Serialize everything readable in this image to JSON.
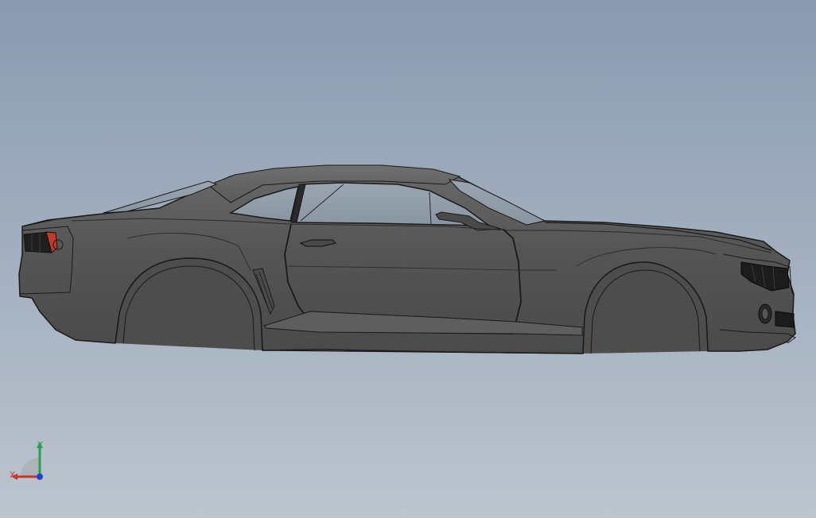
{
  "viewport": {
    "background_top": "#8a9bb0",
    "background_bottom": "#bcc4ce"
  },
  "model": {
    "body_color": "#565656",
    "edge_color": "#1a1a1a",
    "glass_color": "#8f9aa6",
    "taillight_color": "#c0392b"
  },
  "triad": {
    "x_label": "X",
    "y_label": "Y",
    "x_color": "#c0392b",
    "y_color": "#27a14a",
    "z_color": "#2240c8"
  }
}
